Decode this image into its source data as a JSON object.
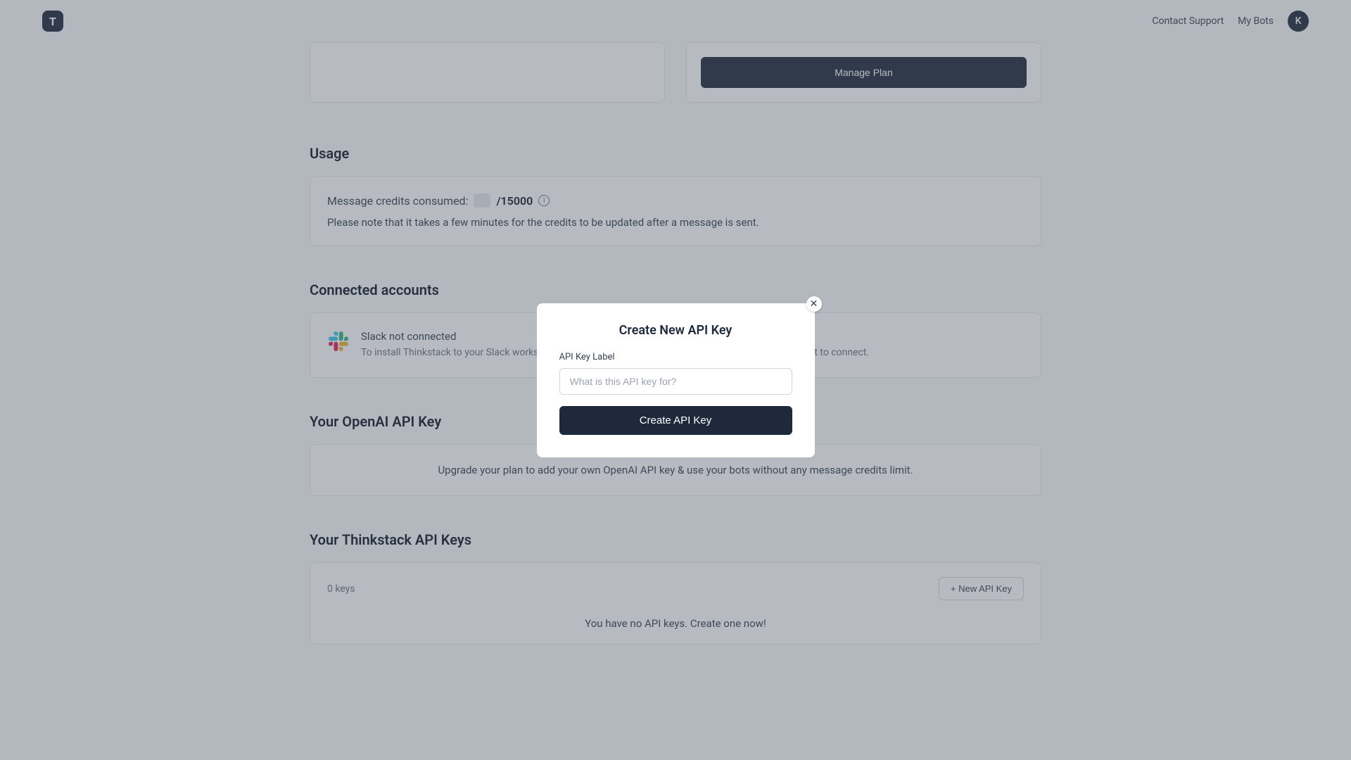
{
  "header": {
    "logo_letter": "T",
    "contact_support": "Contact Support",
    "my_bots": "My Bots",
    "avatar_letter": "K"
  },
  "manage_plan_button": "Manage Plan",
  "usage": {
    "title": "Usage",
    "credits_label": "Message credits consumed:",
    "credits_total": "/15000",
    "note": "Please note that it takes a few minutes for the credits to be updated after a message is sent."
  },
  "connected_accounts": {
    "title": "Connected accounts",
    "slack_title": "Slack not connected",
    "slack_desc": "To install Thinkstack to your Slack workspace, please go to the \"Integrations\" tab of the chatbot you want to connect."
  },
  "openai": {
    "title": "Your OpenAI API Key",
    "upgrade_text": "Upgrade your plan to add your own OpenAI API key & use your bots without any message credits limit."
  },
  "thinkstack_keys": {
    "title": "Your Thinkstack API Keys",
    "count": "0 keys",
    "new_button": "+ New API Key",
    "no_keys": "You have no API keys. Create one now!"
  },
  "modal": {
    "title": "Create New API Key",
    "label": "API Key Label",
    "placeholder": "What is this API key for?",
    "button": "Create API Key",
    "close": "✕"
  }
}
